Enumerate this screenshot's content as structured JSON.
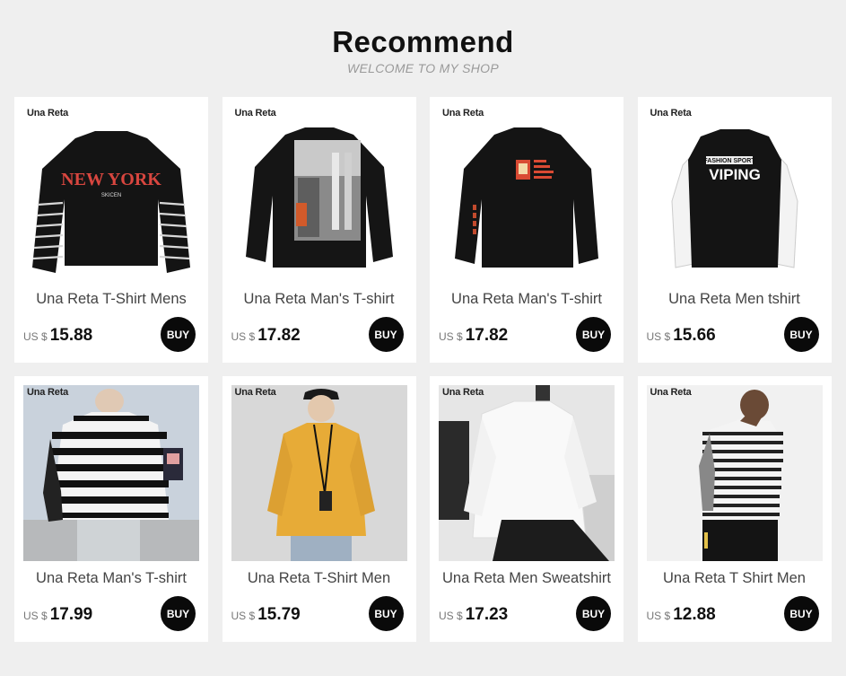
{
  "header": {
    "title": "Recommend",
    "subtitle": "WELCOME TO MY SHOP"
  },
  "brand": "Una Reta",
  "buy_label": "BUY",
  "products": [
    {
      "name": "Una Reta T-Shirt Mens",
      "currency": "US $",
      "price": "15.88",
      "print_text": "NEW YORK",
      "print_sub": "SKICEN"
    },
    {
      "name": "Una Reta Man's T-shirt",
      "currency": "US $",
      "price": "17.82"
    },
    {
      "name": "Una Reta Man's T-shirt",
      "currency": "US $",
      "price": "17.82"
    },
    {
      "name": "Una Reta Men tshirt",
      "currency": "US $",
      "price": "15.66",
      "print_text": "VIPING",
      "print_sub": "FASHION SPORT"
    },
    {
      "name": "Una Reta Man's T-shirt",
      "currency": "US $",
      "price": "17.99"
    },
    {
      "name": "Una Reta T-Shirt Men",
      "currency": "US $",
      "price": "15.79"
    },
    {
      "name": "Una Reta Men Sweatshirt",
      "currency": "US $",
      "price": "17.23"
    },
    {
      "name": "Una Reta T Shirt Men",
      "currency": "US $",
      "price": "12.88"
    }
  ]
}
